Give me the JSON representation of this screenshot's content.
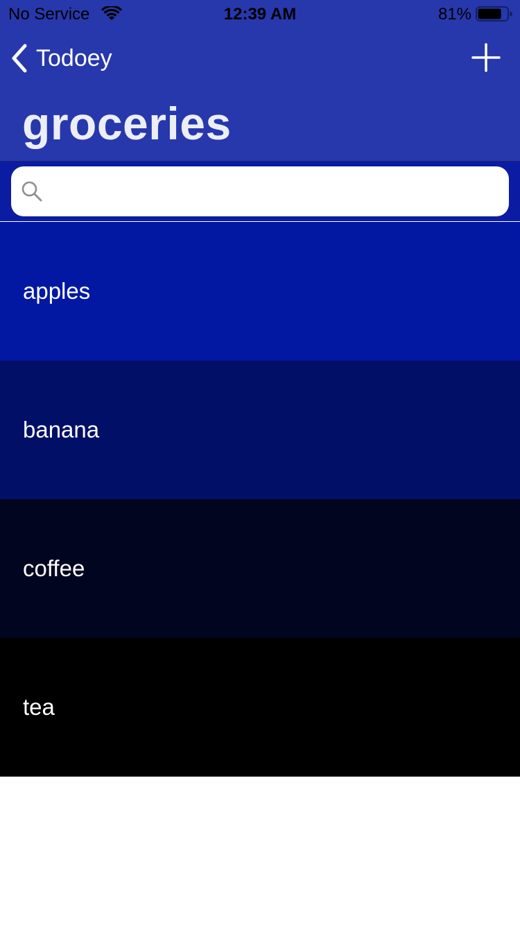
{
  "status_bar": {
    "carrier": "No Service",
    "time": "12:39 AM",
    "battery_percent": "81%",
    "battery_level": 0.81,
    "wifi_icon": "wifi-icon",
    "battery_icon": "battery-icon"
  },
  "nav": {
    "back_label": "Todoey",
    "back_icon": "chevron-left-icon",
    "add_icon": "plus-icon"
  },
  "page": {
    "title": "groceries"
  },
  "search": {
    "value": "",
    "placeholder": "",
    "icon": "search-icon"
  },
  "items": [
    {
      "label": "apples",
      "color": "#0218A3"
    },
    {
      "label": "banana",
      "color": "#020F66"
    },
    {
      "label": "coffee",
      "color": "#01051F"
    },
    {
      "label": "tea",
      "color": "#000000"
    }
  ],
  "colors": {
    "nav_background": "#2738AC",
    "search_background": "#0C1CA2",
    "title_text": "#ECEEF6",
    "list_text": "#FFFFFF"
  }
}
